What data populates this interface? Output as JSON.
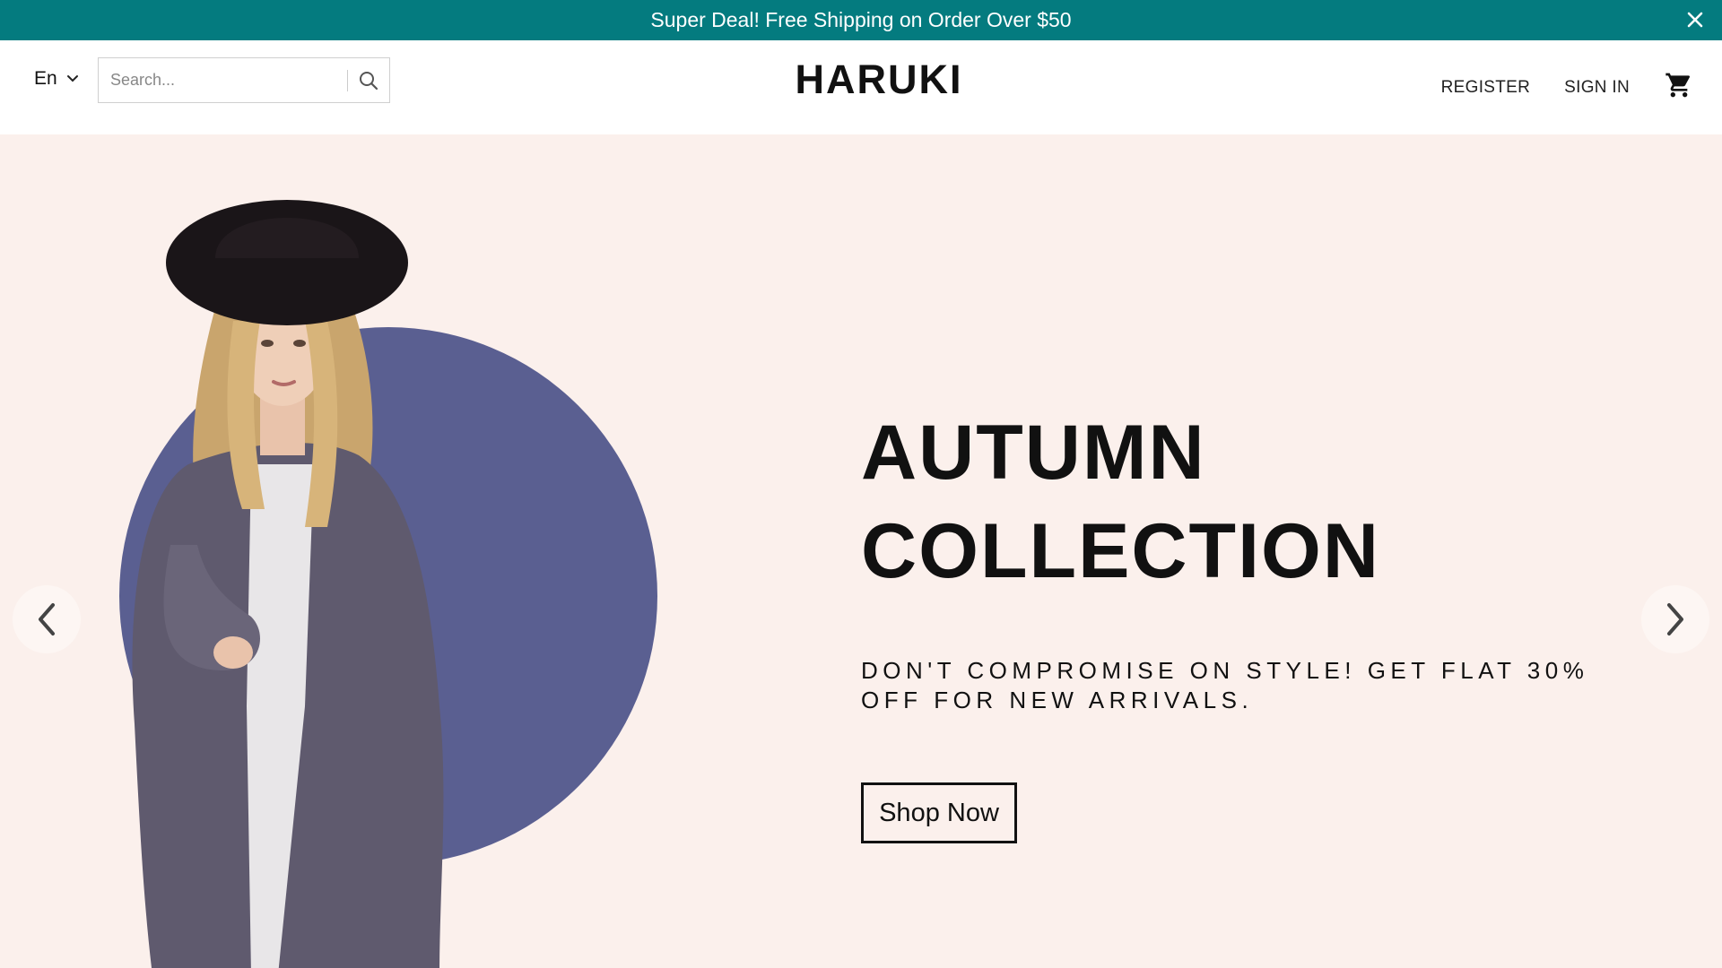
{
  "promo": {
    "text": "Super Deal! Free Shipping on Order Over $50",
    "close_icon": "close-icon",
    "background": "#047b7f"
  },
  "header": {
    "language": "En",
    "search_placeholder": "Search...",
    "logo": "HARUKI",
    "register": "REGISTER",
    "sign_in": "SIGN IN",
    "cart_icon": "cart-icon"
  },
  "hero": {
    "headline_line1": "AUTUMN",
    "headline_line2": "COLLECTION",
    "subline": "Don't compromise on style! Get flat 30% off for new arrivals.",
    "cta": "Shop Now",
    "accent_color": "#5a5f91",
    "background": "#fbf0ec",
    "prev_icon": "chevron-left-icon",
    "next_icon": "chevron-right-icon"
  }
}
